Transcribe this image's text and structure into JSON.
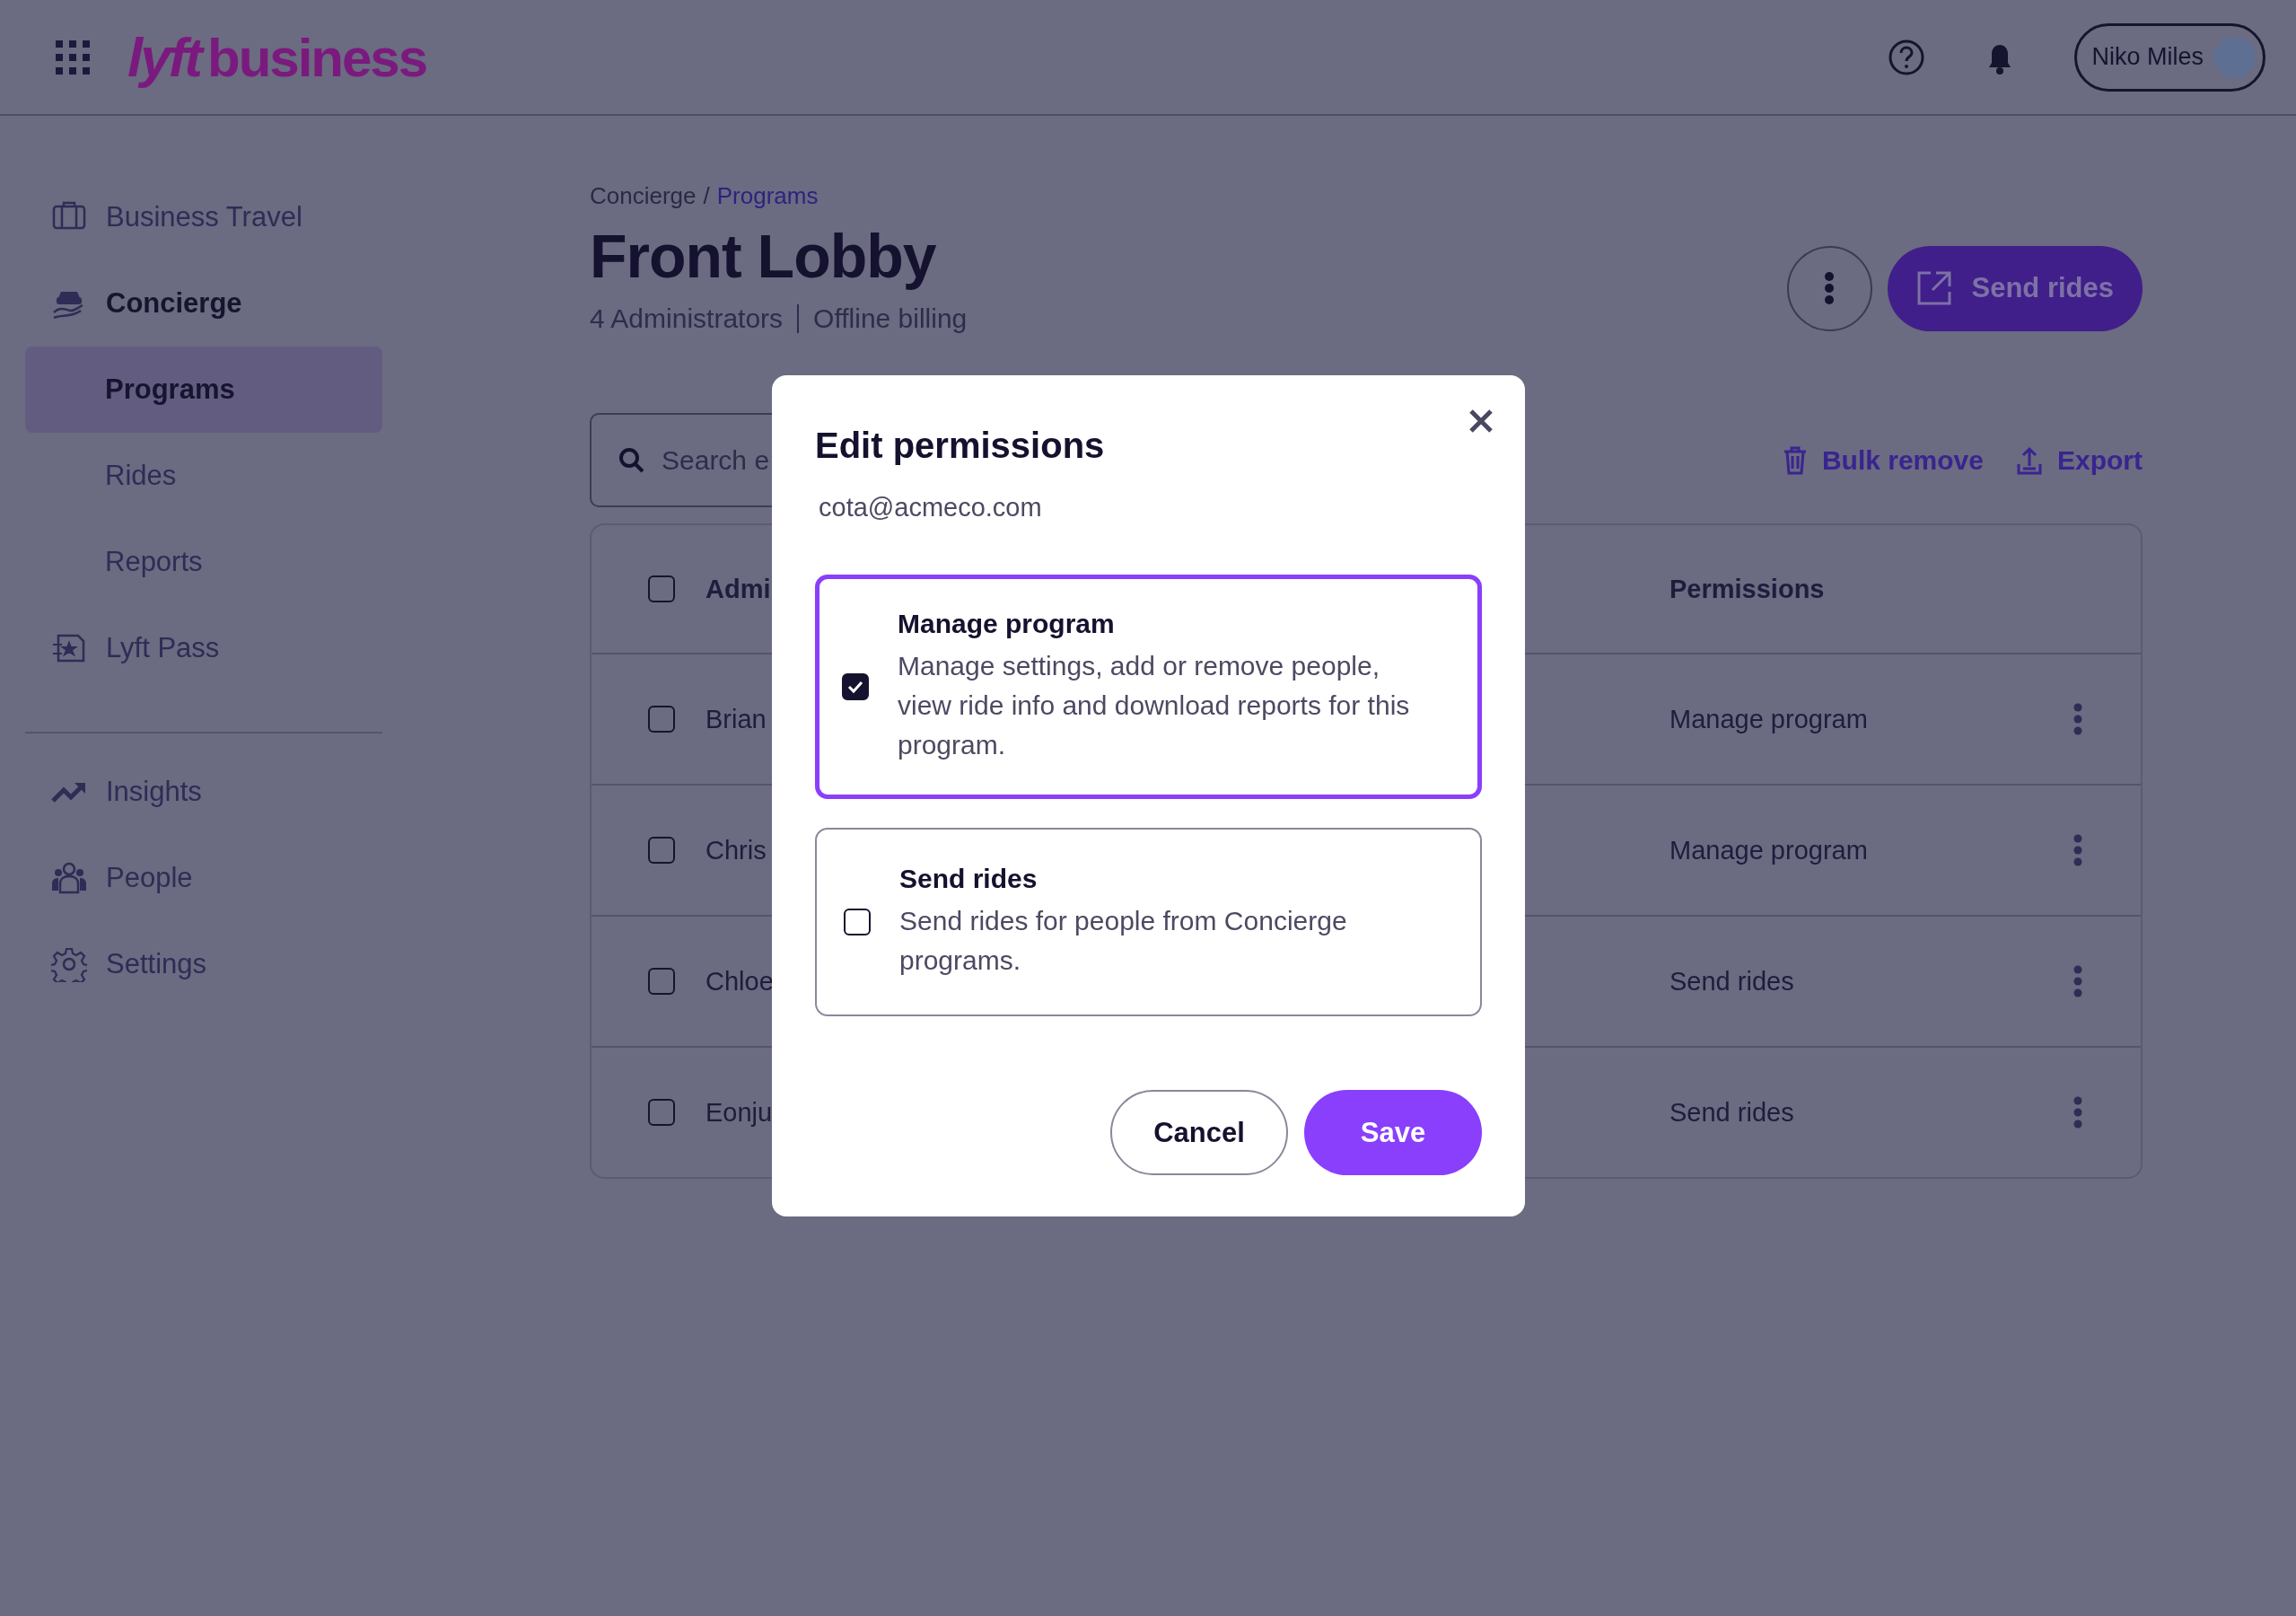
{
  "header": {
    "logo_mark": "lyft",
    "logo_text": "business",
    "user": {
      "name": "Niko Miles"
    }
  },
  "sidebar": {
    "sections": [
      {
        "items": [
          {
            "label": "Business Travel",
            "expanded": false
          },
          {
            "label": "Concierge",
            "expanded": true,
            "children": [
              {
                "label": "Programs",
                "selected": true
              },
              {
                "label": "Rides",
                "selected": false
              },
              {
                "label": "Reports",
                "selected": false
              }
            ]
          },
          {
            "label": "Lyft Pass",
            "expanded": false
          }
        ]
      },
      {
        "items": [
          {
            "label": "Insights",
            "expanded": false
          },
          {
            "label": "People",
            "expanded": false
          },
          {
            "label": "Settings",
            "expanded": false
          }
        ]
      }
    ]
  },
  "breadcrumb": {
    "items": [
      {
        "label": "Concierge",
        "link": false
      },
      {
        "label": "Programs",
        "link": true
      }
    ],
    "separator": "/"
  },
  "page": {
    "title": "Front Lobby",
    "subtitle": [
      "4 Administrators",
      "Offline billing"
    ],
    "primary_action": "Send rides"
  },
  "toolbar": {
    "search": {
      "placeholder": "Search e"
    },
    "actions": [
      "Bulk remove",
      "Export"
    ]
  },
  "table": {
    "select_all": {
      "checked": false
    },
    "columns": [
      "Admi",
      "Permissions"
    ],
    "rows": [
      {
        "checked": false,
        "name": "Brian",
        "permission": "Manage program"
      },
      {
        "checked": false,
        "name": "Chris",
        "permission": "Manage program"
      },
      {
        "checked": false,
        "name": "Chloe",
        "permission": "Send rides"
      },
      {
        "checked": false,
        "name": "Eonju",
        "permission": "Send rides"
      }
    ]
  },
  "modal": {
    "title": "Edit permissions",
    "subtitle": "cota@acmeco.com",
    "options": [
      {
        "title": "Manage program",
        "description": "Manage settings, add or remove people, view ride info and download reports for this program.",
        "checked": true
      },
      {
        "title": "Send rides",
        "description": "Send rides for people from Concierge programs.",
        "checked": false
      }
    ],
    "buttons": [
      {
        "label": "Cancel",
        "kind": "secondary"
      },
      {
        "label": "Save",
        "kind": "primary"
      }
    ]
  }
}
